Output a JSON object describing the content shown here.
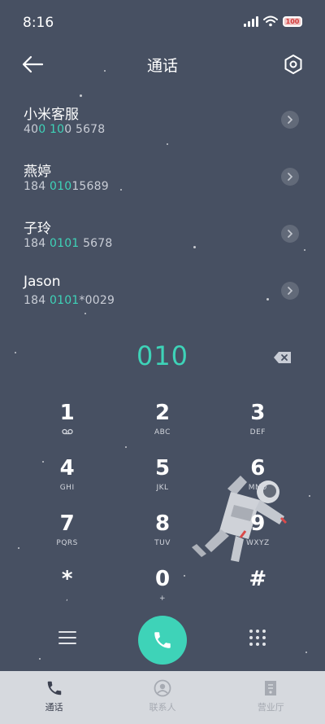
{
  "status_bar": {
    "time": "8:16",
    "battery": "100"
  },
  "header": {
    "title": "通话"
  },
  "contacts": [
    {
      "name": "小米客服",
      "number_parts": [
        "40",
        "0",
        " ",
        "10",
        "0 5678"
      ],
      "highlight": [
        false,
        true,
        false,
        true,
        false
      ]
    },
    {
      "name": "燕婷",
      "number_parts": [
        "184 ",
        "010",
        "15689"
      ],
      "highlight": [
        false,
        true,
        false
      ]
    },
    {
      "name": "子玲",
      "number_parts": [
        "184 ",
        "0101",
        " 5678"
      ],
      "highlight": [
        false,
        true,
        false
      ]
    },
    {
      "name": "Jason",
      "number_parts": [
        "184 ",
        "0101",
        "*0029"
      ],
      "highlight": [
        false,
        true,
        false
      ]
    }
  ],
  "dialed_number": "010",
  "keypad": [
    {
      "digit": "1",
      "letters": "voicemail"
    },
    {
      "digit": "2",
      "letters": "ABC"
    },
    {
      "digit": "3",
      "letters": "DEF"
    },
    {
      "digit": "4",
      "letters": "GHI"
    },
    {
      "digit": "5",
      "letters": "JKL"
    },
    {
      "digit": "6",
      "letters": "MNO"
    },
    {
      "digit": "7",
      "letters": "PQRS"
    },
    {
      "digit": "8",
      "letters": "TUV"
    },
    {
      "digit": "9",
      "letters": "WXYZ"
    },
    {
      "digit": "*",
      "letters": ","
    },
    {
      "digit": "0",
      "letters": "+"
    },
    {
      "digit": "#",
      "letters": ""
    }
  ],
  "tabs": [
    {
      "label": "通话",
      "icon": "phone-icon",
      "active": true
    },
    {
      "label": "联系人",
      "icon": "contact-icon",
      "active": false
    },
    {
      "label": "营业厅",
      "icon": "store-icon",
      "active": false
    }
  ],
  "colors": {
    "background": "#475062",
    "accent": "#3ed3b8",
    "tabbar": "#d6d9de"
  }
}
